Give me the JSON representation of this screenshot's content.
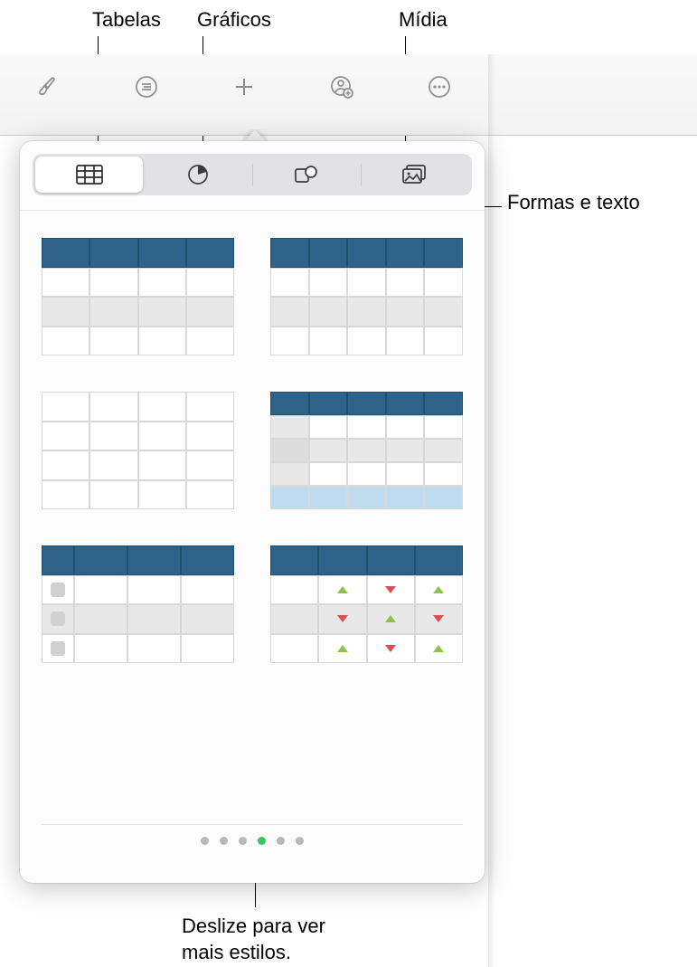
{
  "callouts": {
    "tables": "Tabelas",
    "charts": "Gráficos",
    "media": "Mídia",
    "shapes_text": "Formas e texto",
    "swipe_hint": "Deslize para ver\nmais estilos."
  },
  "toolbar": {
    "items": [
      "format-brush",
      "indent-icon",
      "insert-plus",
      "collaborate-icon",
      "more-icon"
    ]
  },
  "segmented": {
    "items": [
      {
        "name": "tables",
        "icon": "table-icon",
        "active": true
      },
      {
        "name": "charts",
        "icon": "pie-chart-icon",
        "active": false
      },
      {
        "name": "shapes",
        "icon": "shapes-icon",
        "active": false
      },
      {
        "name": "media",
        "icon": "media-icon",
        "active": false
      }
    ]
  },
  "table_styles": {
    "count": 6,
    "styles": [
      {
        "id": "header-blue-zebra-4col"
      },
      {
        "id": "header-blue-zebra-5col"
      },
      {
        "id": "plain-grid-4col"
      },
      {
        "id": "header-blue-highlight-row"
      },
      {
        "id": "header-blue-checkbox-col"
      },
      {
        "id": "header-blue-trend-arrows"
      }
    ]
  },
  "pagination": {
    "total": 6,
    "active_index": 3
  },
  "colors": {
    "header_blue": "#2d6289",
    "highlight_blue": "#bfdcee",
    "zebra_gray": "#e8e8e8",
    "up_arrow": "#8bc34a",
    "down_arrow": "#d85050",
    "dot_active": "#34c759"
  }
}
